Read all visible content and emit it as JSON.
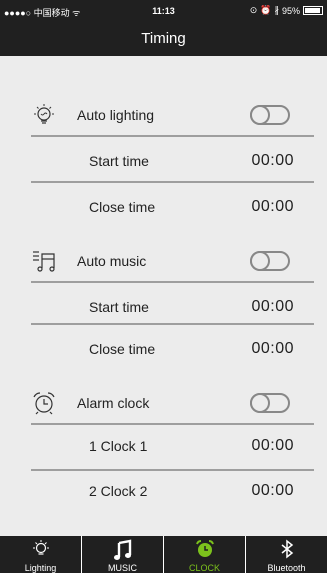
{
  "status": {
    "carrier": "●●●●○ 中国移动 ᯤ",
    "time": "11:13",
    "battery": "95%"
  },
  "header": {
    "title": "Timing"
  },
  "sections": [
    {
      "title": "Auto lighting",
      "toggle_on": false,
      "rows": [
        {
          "label": "Start time",
          "value": "00:00"
        },
        {
          "label": "Close time",
          "value": "00:00"
        }
      ]
    },
    {
      "title": "Auto music",
      "toggle_on": false,
      "rows": [
        {
          "label": "Start time",
          "value": "00:00"
        },
        {
          "label": "Close time",
          "value": "00:00"
        }
      ]
    },
    {
      "title": "Alarm clock",
      "toggle_on": false,
      "rows": [
        {
          "label": "1 Clock 1",
          "value": "00:00"
        },
        {
          "label": "2 Clock 2",
          "value": "00:00"
        }
      ]
    }
  ],
  "tabs": [
    {
      "label": "Lighting",
      "icon": "bulb-icon",
      "active": false
    },
    {
      "label": "MUSIC",
      "icon": "music-note-icon",
      "active": false
    },
    {
      "label": "CLOCK",
      "icon": "alarm-clock-icon",
      "active": true
    },
    {
      "label": "Bluetooth",
      "icon": "bluetooth-icon",
      "active": false
    }
  ],
  "colors": {
    "accent": "#7cc21c",
    "bar": "#202020",
    "background": "#ececec",
    "divider": "#9e9e9e"
  }
}
